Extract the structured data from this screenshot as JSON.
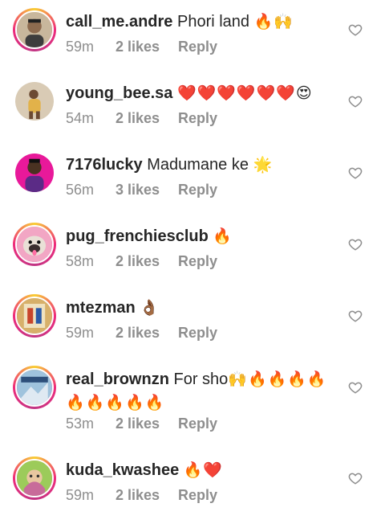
{
  "comments": [
    {
      "username": "call_me.andre",
      "text": "Phori land",
      "emoji": "🔥🙌",
      "emoji2": "",
      "time": "59m",
      "likes": "2 likes",
      "reply": "Reply",
      "avatar_icon": "person-photo",
      "avatar_color": "#8d6b4f"
    },
    {
      "username": "young_bee.sa",
      "text": "",
      "emoji": "❤️❤️❤️❤️❤️❤️😍",
      "emoji2": "",
      "time": "54m",
      "likes": "2 likes",
      "reply": "Reply",
      "avatar_icon": "person-photo",
      "avatar_color": "#e2b24a"
    },
    {
      "username": "7176lucky",
      "text": "Madumane ke",
      "emoji": "🌟",
      "emoji2": "",
      "time": "56m",
      "likes": "3 likes",
      "reply": "Reply",
      "avatar_icon": "person-photo",
      "avatar_color": "#e8199a"
    },
    {
      "username": "pug_frenchiesclub",
      "text": "",
      "emoji": "🔥",
      "emoji2": "",
      "time": "58m",
      "likes": "2 likes",
      "reply": "Reply",
      "avatar_icon": "pug-photo",
      "avatar_color": "#f2a6c4"
    },
    {
      "username": "mtezman",
      "text": "",
      "emoji": "👌🏾",
      "emoji2": "",
      "time": "59m",
      "likes": "2 likes",
      "reply": "Reply",
      "avatar_icon": "poster-photo",
      "avatar_color": "#d7b06a"
    },
    {
      "username": "real_brownzn",
      "text": "For sho",
      "emoji": "🙌🔥🔥🔥🔥",
      "emoji2": "🔥🔥🔥🔥🔥",
      "time": "53m",
      "likes": "2 likes",
      "reply": "Reply",
      "avatar_icon": "logo-photo",
      "avatar_color": "#9fc3dd"
    },
    {
      "username": "kuda_kwashee",
      "text": "",
      "emoji": "🔥❤️",
      "emoji2": "",
      "time": "59m",
      "likes": "2 likes",
      "reply": "Reply",
      "avatar_icon": "person-photo",
      "avatar_color": "#9ccb5a"
    }
  ],
  "icons": {
    "like": "heart-outline-icon"
  },
  "colors": {
    "meta": "#8e8e8e",
    "text": "#262626",
    "story_ring": "#ee2a7b"
  }
}
